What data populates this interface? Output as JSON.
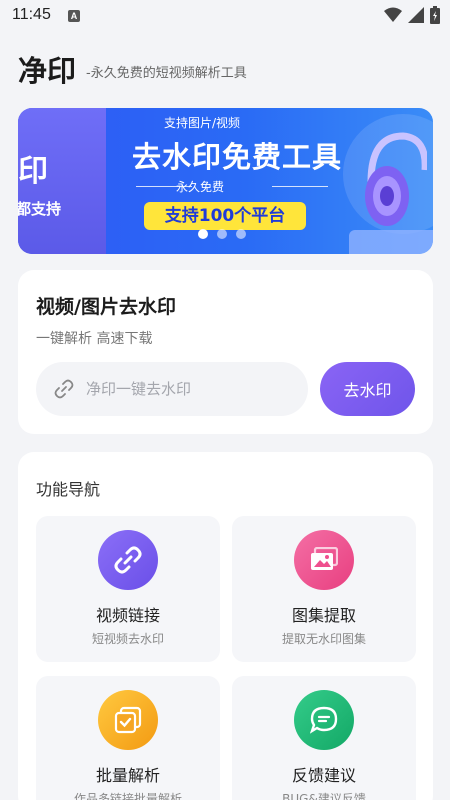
{
  "status": {
    "time": "11:45",
    "sim_label": "A"
  },
  "header": {
    "title": "净印",
    "subtitle": "-永久免费的短视频解析工具"
  },
  "banner": {
    "left_big": "印",
    "left_small": "都支持",
    "top_tag": "支持图片/视频",
    "headline": "去水印免费工具",
    "mid_tag": "永久免费",
    "pill": "支持100个平台",
    "slide_count": 3,
    "active_slide": 1
  },
  "main": {
    "title": "视频/图片去水印",
    "subtitle": "一键解析 高速下载",
    "input_placeholder": "净印一键去水印",
    "input_value": "",
    "button_label": "去水印"
  },
  "nav": {
    "title": "功能导航",
    "items": [
      {
        "name": "视频链接",
        "desc": "短视频去水印",
        "icon": "link-icon",
        "color": "#7a5cf0"
      },
      {
        "name": "图集提取",
        "desc": "提取无水印图集",
        "icon": "image-icon",
        "color": "#ef4f8e"
      },
      {
        "name": "批量解析",
        "desc": "作品多链接批量解析",
        "icon": "batch-icon",
        "color": "#f5a623"
      },
      {
        "name": "反馈建议",
        "desc": "BUG&建议反馈",
        "icon": "chat-icon",
        "color": "#20b574"
      }
    ]
  },
  "colors": {
    "accent": "#6f55ea",
    "background": "#f3f4f7"
  }
}
